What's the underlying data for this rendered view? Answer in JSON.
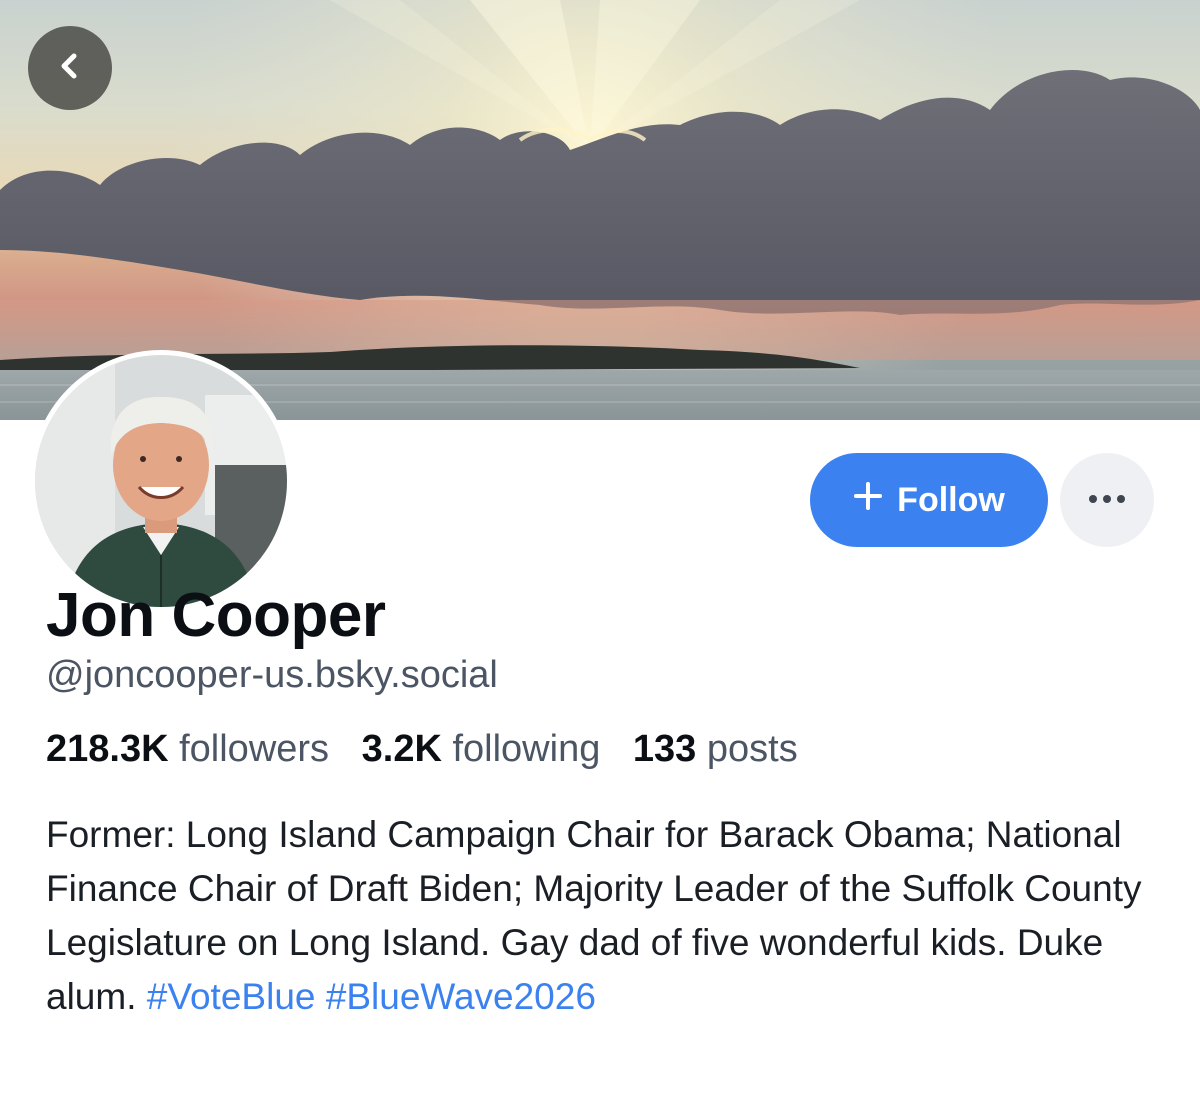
{
  "profile": {
    "name": "Jon Cooper",
    "handle": "@joncooper-us.bsky.social",
    "stats": {
      "followers_count": "218.3K",
      "followers_label": "followers",
      "following_count": "3.2K",
      "following_label": "following",
      "posts_count": "133",
      "posts_label": "posts"
    },
    "bio": {
      "text": "Former: Long Island Campaign Chair for Barack Obama; National Finance Chair of Draft Biden; Majority Leader of the Suffolk County Legislature on Long Island. Gay dad of five wonderful kids. Duke alum.",
      "hashtags": [
        "#VoteBlue",
        "#BlueWave2026"
      ]
    }
  },
  "actions": {
    "follow_label": "Follow",
    "follow_icon": "plus-icon",
    "more_icon": "ellipsis-icon",
    "back_icon": "chevron-left-icon"
  },
  "colors": {
    "accent": "#3b82f0",
    "text_primary": "#0b0f14",
    "text_secondary": "#4b5563",
    "more_button_bg": "#eef0f3"
  }
}
